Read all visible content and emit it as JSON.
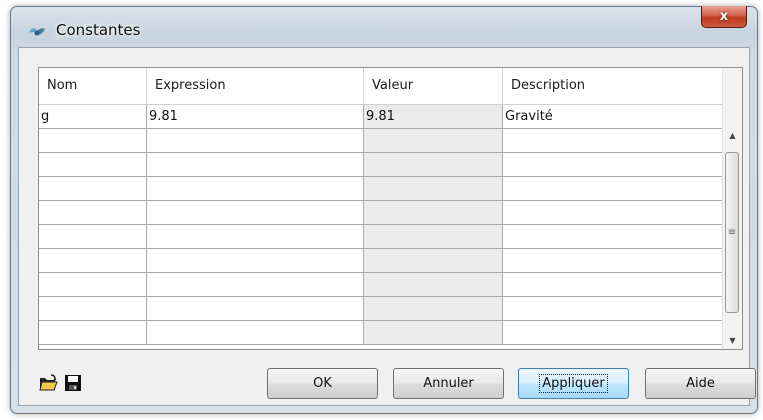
{
  "window": {
    "title": "Constantes",
    "app_icon": "app-icon",
    "close_label": "x"
  },
  "table": {
    "columns": [
      "Nom",
      "Expression",
      "Valeur",
      "Description"
    ],
    "rows": [
      {
        "nom": "g",
        "expression": "9.81",
        "valeur": "9.81",
        "description": "Gravité"
      },
      {
        "nom": "",
        "expression": "",
        "valeur": "",
        "description": ""
      },
      {
        "nom": "",
        "expression": "",
        "valeur": "",
        "description": ""
      },
      {
        "nom": "",
        "expression": "",
        "valeur": "",
        "description": ""
      },
      {
        "nom": "",
        "expression": "",
        "valeur": "",
        "description": ""
      },
      {
        "nom": "",
        "expression": "",
        "valeur": "",
        "description": ""
      },
      {
        "nom": "",
        "expression": "",
        "valeur": "",
        "description": ""
      },
      {
        "nom": "",
        "expression": "",
        "valeur": "",
        "description": ""
      },
      {
        "nom": "",
        "expression": "",
        "valeur": "",
        "description": ""
      },
      {
        "nom": "",
        "expression": "",
        "valeur": "",
        "description": ""
      }
    ]
  },
  "toolbar": {
    "open_icon": "open-folder-icon",
    "save_icon": "save-disk-icon"
  },
  "buttons": {
    "ok": "OK",
    "cancel": "Annuler",
    "apply": "Appliquer",
    "help": "Aide"
  }
}
